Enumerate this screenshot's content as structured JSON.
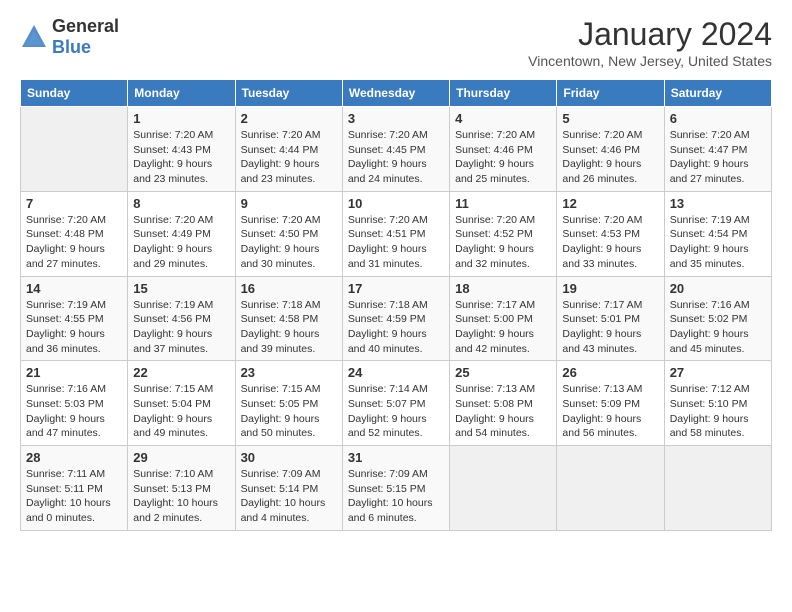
{
  "logo": {
    "text_general": "General",
    "text_blue": "Blue"
  },
  "header": {
    "month_year": "January 2024",
    "location": "Vincentown, New Jersey, United States"
  },
  "weekdays": [
    "Sunday",
    "Monday",
    "Tuesday",
    "Wednesday",
    "Thursday",
    "Friday",
    "Saturday"
  ],
  "weeks": [
    [
      {
        "day": "",
        "sunrise": "",
        "sunset": "",
        "daylight": "",
        "empty": true
      },
      {
        "day": "1",
        "sunrise": "Sunrise: 7:20 AM",
        "sunset": "Sunset: 4:43 PM",
        "daylight": "Daylight: 9 hours and 23 minutes."
      },
      {
        "day": "2",
        "sunrise": "Sunrise: 7:20 AM",
        "sunset": "Sunset: 4:44 PM",
        "daylight": "Daylight: 9 hours and 23 minutes."
      },
      {
        "day": "3",
        "sunrise": "Sunrise: 7:20 AM",
        "sunset": "Sunset: 4:45 PM",
        "daylight": "Daylight: 9 hours and 24 minutes."
      },
      {
        "day": "4",
        "sunrise": "Sunrise: 7:20 AM",
        "sunset": "Sunset: 4:46 PM",
        "daylight": "Daylight: 9 hours and 25 minutes."
      },
      {
        "day": "5",
        "sunrise": "Sunrise: 7:20 AM",
        "sunset": "Sunset: 4:46 PM",
        "daylight": "Daylight: 9 hours and 26 minutes."
      },
      {
        "day": "6",
        "sunrise": "Sunrise: 7:20 AM",
        "sunset": "Sunset: 4:47 PM",
        "daylight": "Daylight: 9 hours and 27 minutes."
      }
    ],
    [
      {
        "day": "7",
        "sunrise": "Sunrise: 7:20 AM",
        "sunset": "Sunset: 4:48 PM",
        "daylight": "Daylight: 9 hours and 27 minutes."
      },
      {
        "day": "8",
        "sunrise": "Sunrise: 7:20 AM",
        "sunset": "Sunset: 4:49 PM",
        "daylight": "Daylight: 9 hours and 29 minutes."
      },
      {
        "day": "9",
        "sunrise": "Sunrise: 7:20 AM",
        "sunset": "Sunset: 4:50 PM",
        "daylight": "Daylight: 9 hours and 30 minutes."
      },
      {
        "day": "10",
        "sunrise": "Sunrise: 7:20 AM",
        "sunset": "Sunset: 4:51 PM",
        "daylight": "Daylight: 9 hours and 31 minutes."
      },
      {
        "day": "11",
        "sunrise": "Sunrise: 7:20 AM",
        "sunset": "Sunset: 4:52 PM",
        "daylight": "Daylight: 9 hours and 32 minutes."
      },
      {
        "day": "12",
        "sunrise": "Sunrise: 7:20 AM",
        "sunset": "Sunset: 4:53 PM",
        "daylight": "Daylight: 9 hours and 33 minutes."
      },
      {
        "day": "13",
        "sunrise": "Sunrise: 7:19 AM",
        "sunset": "Sunset: 4:54 PM",
        "daylight": "Daylight: 9 hours and 35 minutes."
      }
    ],
    [
      {
        "day": "14",
        "sunrise": "Sunrise: 7:19 AM",
        "sunset": "Sunset: 4:55 PM",
        "daylight": "Daylight: 9 hours and 36 minutes."
      },
      {
        "day": "15",
        "sunrise": "Sunrise: 7:19 AM",
        "sunset": "Sunset: 4:56 PM",
        "daylight": "Daylight: 9 hours and 37 minutes."
      },
      {
        "day": "16",
        "sunrise": "Sunrise: 7:18 AM",
        "sunset": "Sunset: 4:58 PM",
        "daylight": "Daylight: 9 hours and 39 minutes."
      },
      {
        "day": "17",
        "sunrise": "Sunrise: 7:18 AM",
        "sunset": "Sunset: 4:59 PM",
        "daylight": "Daylight: 9 hours and 40 minutes."
      },
      {
        "day": "18",
        "sunrise": "Sunrise: 7:17 AM",
        "sunset": "Sunset: 5:00 PM",
        "daylight": "Daylight: 9 hours and 42 minutes."
      },
      {
        "day": "19",
        "sunrise": "Sunrise: 7:17 AM",
        "sunset": "Sunset: 5:01 PM",
        "daylight": "Daylight: 9 hours and 43 minutes."
      },
      {
        "day": "20",
        "sunrise": "Sunrise: 7:16 AM",
        "sunset": "Sunset: 5:02 PM",
        "daylight": "Daylight: 9 hours and 45 minutes."
      }
    ],
    [
      {
        "day": "21",
        "sunrise": "Sunrise: 7:16 AM",
        "sunset": "Sunset: 5:03 PM",
        "daylight": "Daylight: 9 hours and 47 minutes."
      },
      {
        "day": "22",
        "sunrise": "Sunrise: 7:15 AM",
        "sunset": "Sunset: 5:04 PM",
        "daylight": "Daylight: 9 hours and 49 minutes."
      },
      {
        "day": "23",
        "sunrise": "Sunrise: 7:15 AM",
        "sunset": "Sunset: 5:05 PM",
        "daylight": "Daylight: 9 hours and 50 minutes."
      },
      {
        "day": "24",
        "sunrise": "Sunrise: 7:14 AM",
        "sunset": "Sunset: 5:07 PM",
        "daylight": "Daylight: 9 hours and 52 minutes."
      },
      {
        "day": "25",
        "sunrise": "Sunrise: 7:13 AM",
        "sunset": "Sunset: 5:08 PM",
        "daylight": "Daylight: 9 hours and 54 minutes."
      },
      {
        "day": "26",
        "sunrise": "Sunrise: 7:13 AM",
        "sunset": "Sunset: 5:09 PM",
        "daylight": "Daylight: 9 hours and 56 minutes."
      },
      {
        "day": "27",
        "sunrise": "Sunrise: 7:12 AM",
        "sunset": "Sunset: 5:10 PM",
        "daylight": "Daylight: 9 hours and 58 minutes."
      }
    ],
    [
      {
        "day": "28",
        "sunrise": "Sunrise: 7:11 AM",
        "sunset": "Sunset: 5:11 PM",
        "daylight": "Daylight: 10 hours and 0 minutes."
      },
      {
        "day": "29",
        "sunrise": "Sunrise: 7:10 AM",
        "sunset": "Sunset: 5:13 PM",
        "daylight": "Daylight: 10 hours and 2 minutes."
      },
      {
        "day": "30",
        "sunrise": "Sunrise: 7:09 AM",
        "sunset": "Sunset: 5:14 PM",
        "daylight": "Daylight: 10 hours and 4 minutes."
      },
      {
        "day": "31",
        "sunrise": "Sunrise: 7:09 AM",
        "sunset": "Sunset: 5:15 PM",
        "daylight": "Daylight: 10 hours and 6 minutes."
      },
      {
        "day": "",
        "sunrise": "",
        "sunset": "",
        "daylight": "",
        "empty": true
      },
      {
        "day": "",
        "sunrise": "",
        "sunset": "",
        "daylight": "",
        "empty": true
      },
      {
        "day": "",
        "sunrise": "",
        "sunset": "",
        "daylight": "",
        "empty": true
      }
    ]
  ]
}
